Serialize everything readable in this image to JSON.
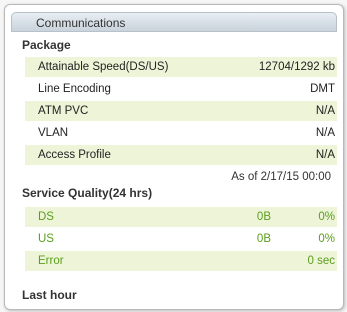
{
  "panel": {
    "title": "Communications"
  },
  "package": {
    "title": "Package",
    "rows": [
      {
        "label": "Attainable Speed(DS/US)",
        "value": "12704/1292 kb"
      },
      {
        "label": "Line Encoding",
        "value": "DMT"
      },
      {
        "label": "ATM PVC",
        "value": "N/A"
      },
      {
        "label": "VLAN",
        "value": "N/A"
      },
      {
        "label": "Access Profile",
        "value": "N/A"
      }
    ],
    "as_of": "As of 2/17/15 00:00"
  },
  "service_quality": {
    "title": "Service Quality(24 hrs)",
    "rows": [
      {
        "label": "DS",
        "bytes": "0B",
        "percent": "0%"
      },
      {
        "label": "US",
        "bytes": "0B",
        "percent": "0%"
      },
      {
        "label": "Error",
        "value": "0 sec"
      }
    ]
  },
  "last_hour": {
    "title": "Last hour"
  },
  "colors": {
    "shaded_row": "#eef4d8",
    "green_text": "#5a9e1c"
  }
}
